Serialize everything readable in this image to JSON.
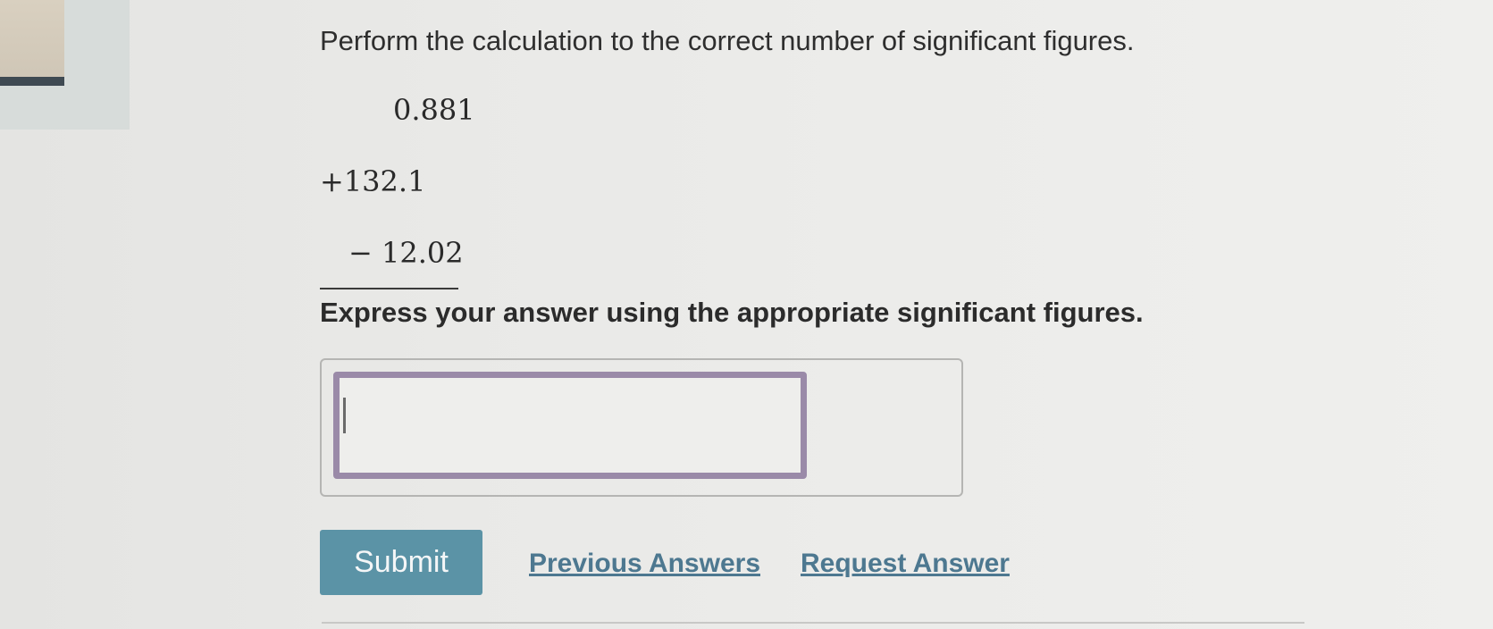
{
  "question": {
    "prompt": "Perform the calculation to the correct number of significant figures.",
    "expression": {
      "line1": "0.881",
      "line2": "+132.1",
      "line3": "− 12.02"
    },
    "instruction": "Express your answer using the appropriate significant figures."
  },
  "answer": {
    "value": "",
    "placeholder": ""
  },
  "actions": {
    "submit_label": "Submit",
    "previous_answers_label": "Previous Answers",
    "request_answer_label": "Request Answer"
  },
  "colors": {
    "submit_bg": "#5b93a6",
    "link": "#4d7890",
    "input_border": "#9a8aa8"
  }
}
